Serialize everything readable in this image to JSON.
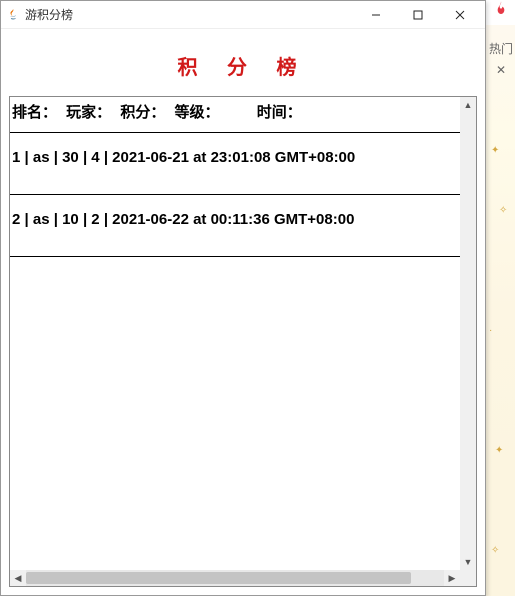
{
  "window": {
    "title": "游积分榜"
  },
  "heading": "积 分 榜",
  "columns": {
    "rank": "排名：",
    "player": "玩家：",
    "score": "积分：",
    "level": "等级：",
    "time": "时间："
  },
  "rows": [
    {
      "rank": "1",
      "player": "as",
      "score": "30",
      "level": "4",
      "time": "2021-06-21 at 23:01:08 GMT+08:00"
    },
    {
      "rank": "2",
      "player": "as",
      "score": "10",
      "level": "2",
      "time": "2021-06-22 at 00:11:36 GMT+08:00"
    }
  ],
  "side": {
    "hot": "热门",
    "close": "✕"
  },
  "sep": "  |  "
}
